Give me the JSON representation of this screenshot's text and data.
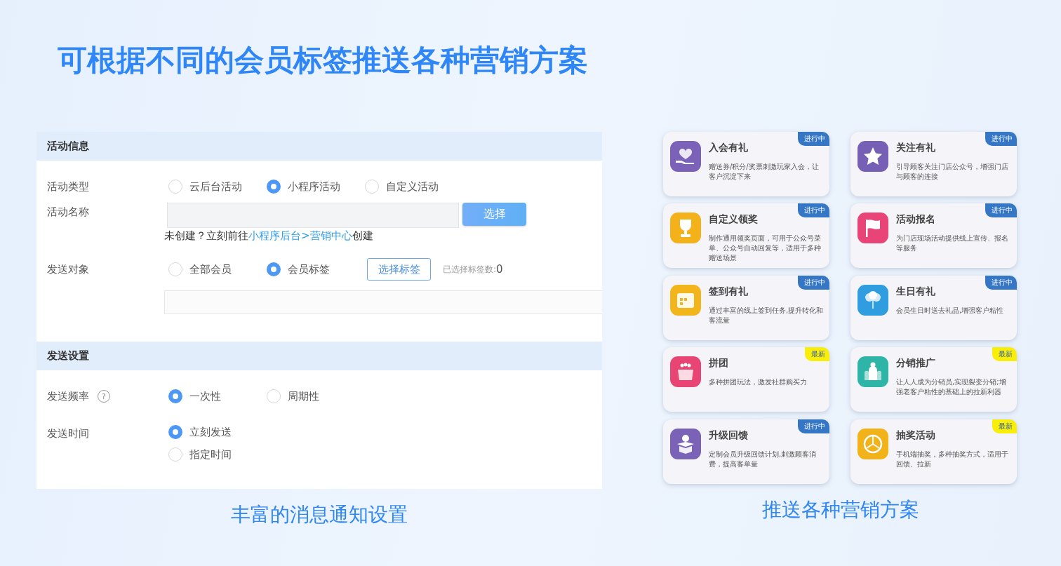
{
  "headline": "可根据不同的会员标签推送各种营销方案",
  "form": {
    "activity_info": {
      "title": "活动信息",
      "activity_type": {
        "label": "活动类型",
        "options": [
          {
            "label": "云后台活动",
            "selected": false
          },
          {
            "label": "小程序活动",
            "selected": true
          },
          {
            "label": "自定义活动",
            "selected": false
          }
        ]
      },
      "activity_name": {
        "label": "活动名称",
        "button": "选择",
        "hint_before": "未创建？立刻前往",
        "hint_link": "小程序后台>营销中心",
        "hint_after": "创建"
      },
      "send_target": {
        "label": "发送对象",
        "options": [
          {
            "label": "全部会员",
            "selected": false
          },
          {
            "label": "会员标签",
            "selected": true
          }
        ],
        "tag_button": "选择标签",
        "count_label": "已选择标签数:",
        "count": "0"
      }
    },
    "send_settings": {
      "title": "发送设置",
      "frequency": {
        "label": "发送频率",
        "help": "?",
        "options": [
          {
            "label": "一次性",
            "selected": true
          },
          {
            "label": "周期性",
            "selected": false
          }
        ]
      },
      "time": {
        "label": "发送时间",
        "options": [
          {
            "label": "立刻发送",
            "selected": true
          },
          {
            "label": "指定时间",
            "selected": false
          }
        ]
      }
    }
  },
  "left_caption": "丰富的消息通知设置",
  "campaigns": [
    {
      "title": "入会有礼",
      "desc": "赠送券/积分/奖票刺激玩家入会，让客户沉淀下来",
      "badge": {
        "text": "进行中",
        "color": "#3577c4"
      },
      "color": "#7b62b8"
    },
    {
      "title": "关注有礼",
      "desc": "引导顾客关注门店公众号，增强门店与顾客的连接",
      "badge": {
        "text": "进行中",
        "color": "#3577c4"
      },
      "color": "#7560b5"
    },
    {
      "title": "自定义领奖",
      "desc": "制作通用领奖页面，可用于公众号菜单、公众号自动回复等，适用于多种赠送场景",
      "badge": {
        "text": "进行中",
        "color": "#3577c4"
      },
      "color": "#f3b21a"
    },
    {
      "title": "活动报名",
      "desc": "为门店现场活动提供线上宣传、报名等服务",
      "badge": {
        "text": "进行中",
        "color": "#3577c4"
      },
      "color": "#e84478"
    },
    {
      "title": "签到有礼",
      "desc": "通过丰富的线上签到任务,提升转化和客流量",
      "badge": {
        "text": "进行中",
        "color": "#3577c4"
      },
      "color": "#f2b51c"
    },
    {
      "title": "生日有礼",
      "desc": "会员生日时送去礼品,增强客户粘性",
      "badge": {
        "text": "进行中",
        "color": "#3577c4"
      },
      "color": "#2f9de0"
    },
    {
      "title": "拼团",
      "desc": "多种拼团玩法，激发社群购买力",
      "badge": {
        "text": "最新",
        "color": "#f8ee0a"
      },
      "color": "#e84574"
    },
    {
      "title": "分销推广",
      "desc": "让人人成为分销员,实现裂变分销;增强老客户粘性的基础上的拉新利器",
      "badge": {
        "text": "最新",
        "color": "#f8ee0a"
      },
      "color": "#2fb5a8"
    },
    {
      "title": "升级回馈",
      "desc": "定制会员升级回馈计划,刺激顾客消费，提高客单量",
      "badge": {
        "text": "进行中",
        "color": "#3577c4"
      },
      "color": "#7a62b6"
    },
    {
      "title": "抽奖活动",
      "desc": "手机端抽奖，多种抽奖方式，适用于回馈、拉新",
      "badge": {
        "text": "最新",
        "color": "#f8ee0a"
      },
      "color": "#f2b21a"
    }
  ],
  "right_caption": "推送各种营销方案"
}
